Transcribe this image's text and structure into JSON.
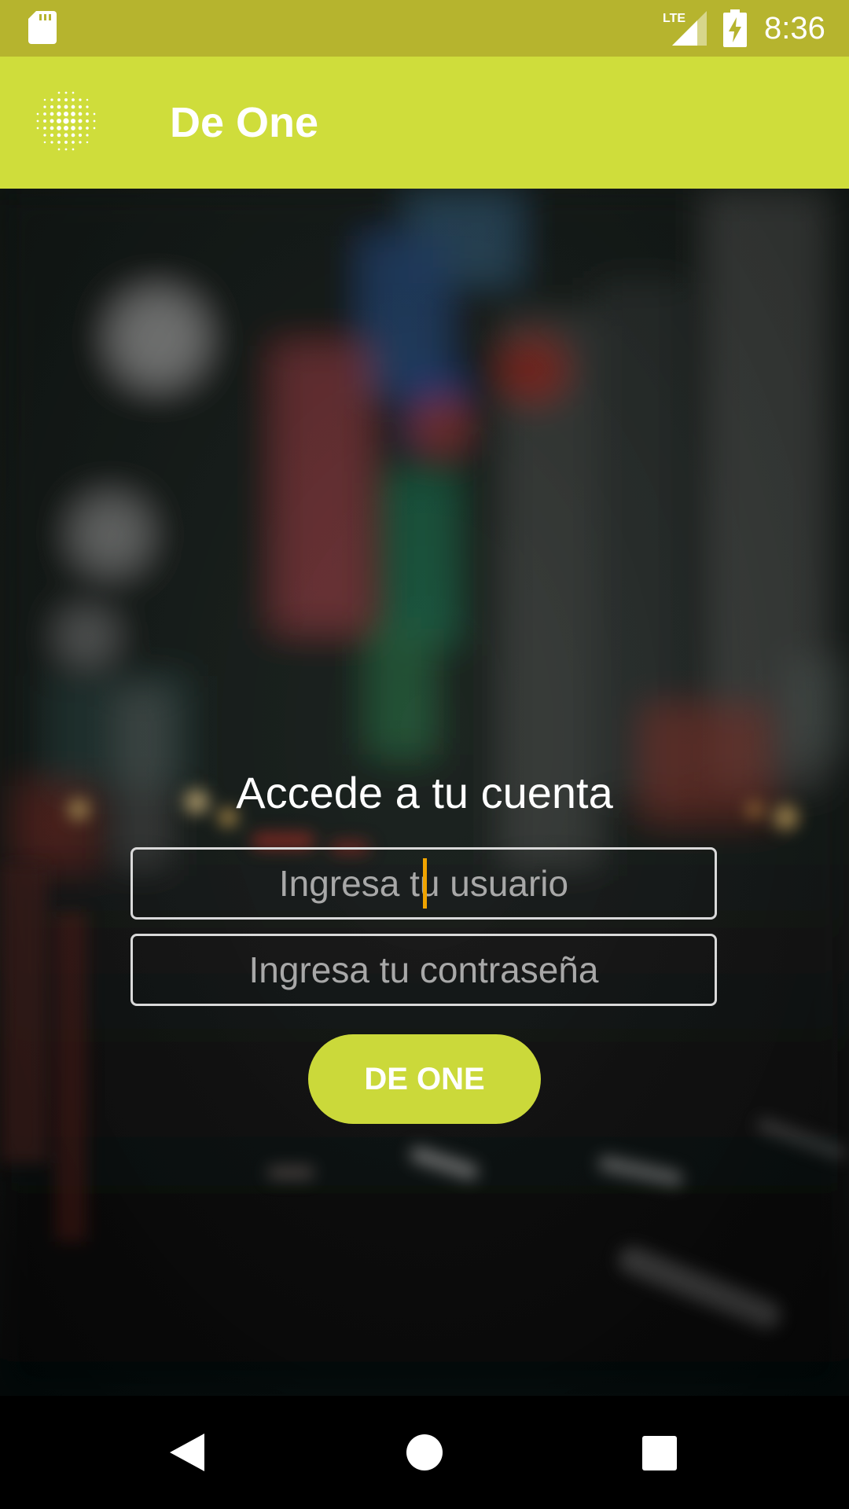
{
  "status_bar": {
    "time": "8:36",
    "network": "LTE",
    "icons": [
      "sd-card-icon",
      "lte-signal-icon",
      "battery-charging-icon"
    ]
  },
  "app_bar": {
    "title": "De One",
    "logo_icon": "dotted-circle-logo-icon",
    "background_color": "#cfdd3b"
  },
  "login": {
    "heading": "Accede a tu cuenta",
    "username_placeholder": "Ingresa tu usuario",
    "username_value": "",
    "password_placeholder": "Ingresa tu contraseña",
    "password_value": "",
    "submit_label": "DE ONE",
    "accent_color": "#cbd93a",
    "caret_color": "#f0a400"
  },
  "nav_bar": {
    "icons": [
      "back-icon",
      "home-icon",
      "recent-apps-icon"
    ]
  }
}
